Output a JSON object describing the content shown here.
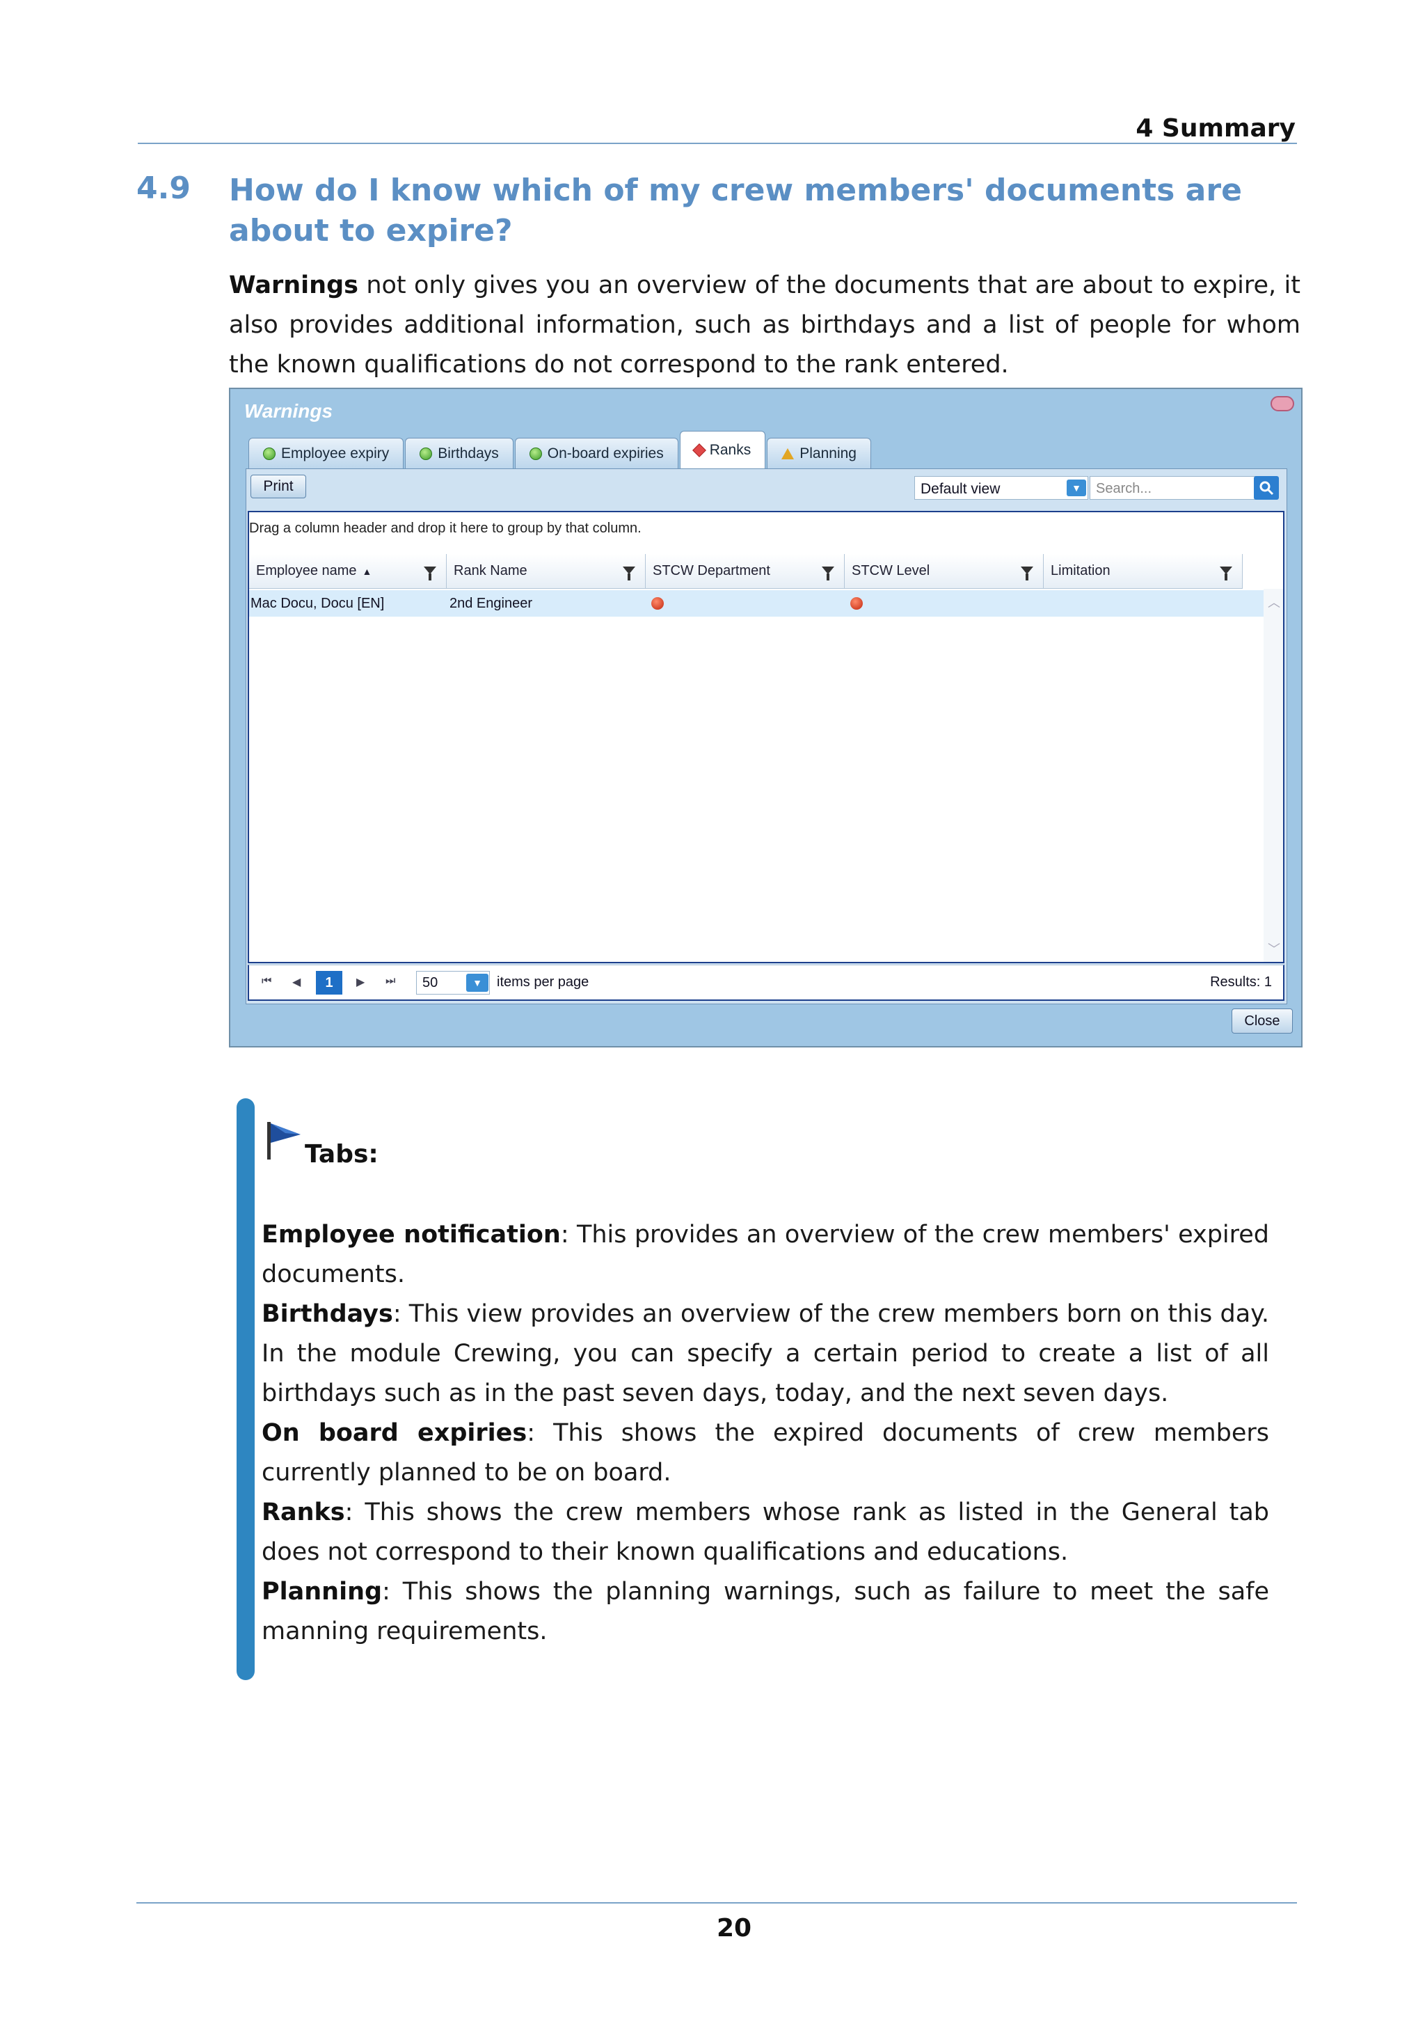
{
  "header": {
    "chapter": "4 Summary"
  },
  "section": {
    "number": "4.9",
    "title": "How do I know which of my crew members' documents are about to expire?"
  },
  "intro": {
    "bold": "Warnings",
    "text": " not only gives you an overview of the documents that are about to expire, it also provides additional information, such as birthdays and a list of people for whom the known qualifications do not correspond to the rank entered."
  },
  "window": {
    "title": "Warnings",
    "tabs": [
      {
        "label": "Employee expiry",
        "icon": "green-circle-icon"
      },
      {
        "label": "Birthdays",
        "icon": "green-circle-icon"
      },
      {
        "label": "On-board expiries",
        "icon": "green-circle-icon"
      },
      {
        "label": "Ranks",
        "icon": "red-diamond-icon"
      },
      {
        "label": "Planning",
        "icon": "warning-triangle-icon"
      }
    ],
    "active_tab": "Ranks",
    "print_label": "Print",
    "view_select": "Default view",
    "search_placeholder": "Search...",
    "group_hint": "Drag a column header and drop it here to group by that column.",
    "columns": [
      "Employee name",
      "Rank Name",
      "STCW Department",
      "STCW Level",
      "Limitation"
    ],
    "sort_indicator": "▲",
    "rows": [
      {
        "employee": "Mac Docu, Docu [EN]",
        "rank": "2nd Engineer",
        "stcw_department": "error-icon",
        "stcw_level": "error-icon",
        "limitation": ""
      }
    ],
    "pager": {
      "current_page": "1",
      "page_size": "50",
      "items_label": "items per page",
      "results": "Results: 1"
    },
    "close_label": "Close",
    "colors": {
      "frame": "#9fc6e4",
      "grid_border": "#1c3f8c",
      "selected_row": "#d8ecfb",
      "accent": "#1e6fc6"
    }
  },
  "note": {
    "title": "Tabs:",
    "icon": "flag-icon",
    "items": [
      {
        "term": "Employee notification",
        "text": ": This provides an overview of the crew members' expired documents."
      },
      {
        "term": "Birthdays",
        "text": ": This view provides an overview of the crew members born on this day. In the module Crewing, you can specify a certain period to create a list of all birthdays such as in the past seven days, today, and the next seven days."
      },
      {
        "term": "On board expiries",
        "text": ": This shows the expired documents of crew members currently planned to be on board."
      },
      {
        "term": "Ranks",
        "text": ": This shows the crew members whose rank as listed in the General tab does not correspond to their known qualifications and educations."
      },
      {
        "term": "Planning",
        "text": ": This shows the planning warnings, such as failure to meet the safe manning requirements."
      }
    ]
  },
  "footer": {
    "page_number": "20"
  }
}
